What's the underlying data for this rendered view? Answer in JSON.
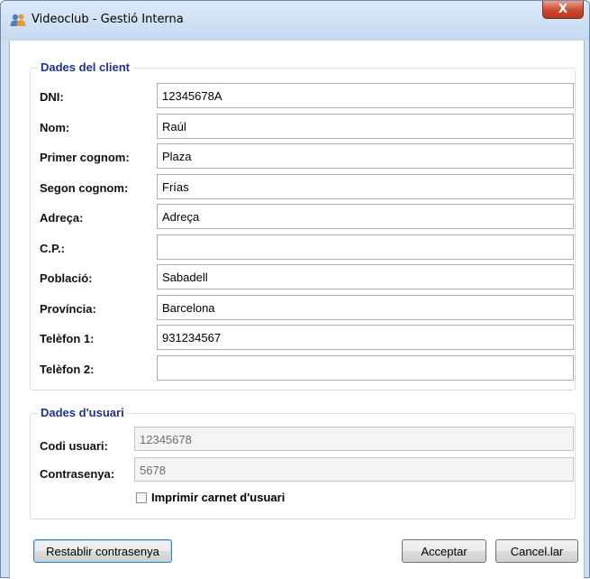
{
  "window": {
    "title": "Videoclub - Gestió Interna",
    "close_glyph": "X",
    "app_icon": "users-icon"
  },
  "client_group": {
    "legend": "Dades del client",
    "fields": [
      {
        "label": "DNI:",
        "value": "12345678A"
      },
      {
        "label": "Nom:",
        "value": "Raúl"
      },
      {
        "label": "Primer cognom:",
        "value": "Plaza"
      },
      {
        "label": "Segon cognom:",
        "value": "Frías"
      },
      {
        "label": "Adreça:",
        "value": "Adreça"
      },
      {
        "label": "C.P.:",
        "value": ""
      },
      {
        "label": "Població:",
        "value": "Sabadell"
      },
      {
        "label": "Província:",
        "value": "Barcelona"
      },
      {
        "label": "Telèfon 1:",
        "value": "931234567"
      },
      {
        "label": "Telèfon 2:",
        "value": ""
      }
    ]
  },
  "user_group": {
    "legend": "Dades d'usuari",
    "user_code_label": "Codi usuari:",
    "user_code_value": "12345678",
    "password_label": "Contrasenya:",
    "password_value": "5678",
    "print_card_label": "Imprimir carnet d'usuari",
    "print_card_checked": false
  },
  "buttons": {
    "reset_password": "Restablir contrasenya",
    "accept": "Acceptar",
    "cancel": "Cancel.lar"
  },
  "colors": {
    "legend": "#1e3287",
    "close_button": "#c94a33",
    "focus_border": "#3c7fb1"
  }
}
